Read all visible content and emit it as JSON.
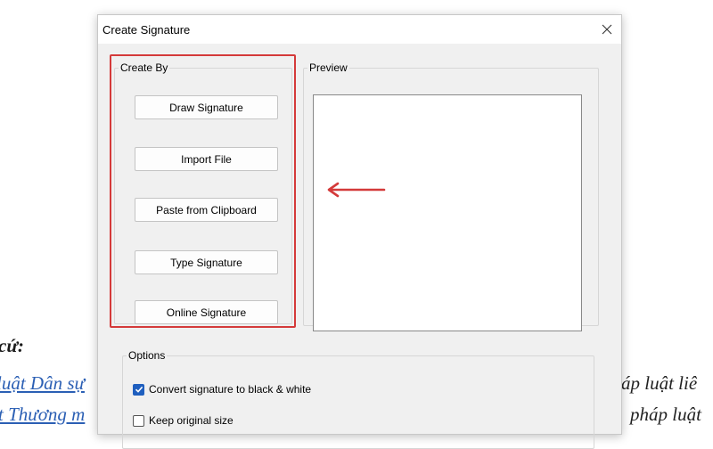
{
  "document": {
    "heading": "cứ:",
    "line1_link": "luật Dân sự",
    "line1_right": "áp luật liê",
    "line2_link": "t Thương m",
    "line2_right": "pháp luật"
  },
  "dialog": {
    "title": "Create Signature",
    "create_by": {
      "legend": "Create By",
      "buttons": [
        "Draw Signature",
        "Import File",
        "Paste from Clipboard",
        "Type Signature",
        "Online Signature"
      ]
    },
    "preview": {
      "legend": "Preview"
    },
    "options": {
      "legend": "Options",
      "items": [
        {
          "label": "Convert signature to black & white",
          "checked": true
        },
        {
          "label": "Keep original size",
          "checked": false
        }
      ]
    }
  },
  "colors": {
    "highlight": "#d43a3a",
    "checkbox_accent": "#1f5fbf",
    "link": "#2b5fb4"
  },
  "icons": [
    "close-icon",
    "checkmark-icon",
    "left-arrow-icon"
  ]
}
